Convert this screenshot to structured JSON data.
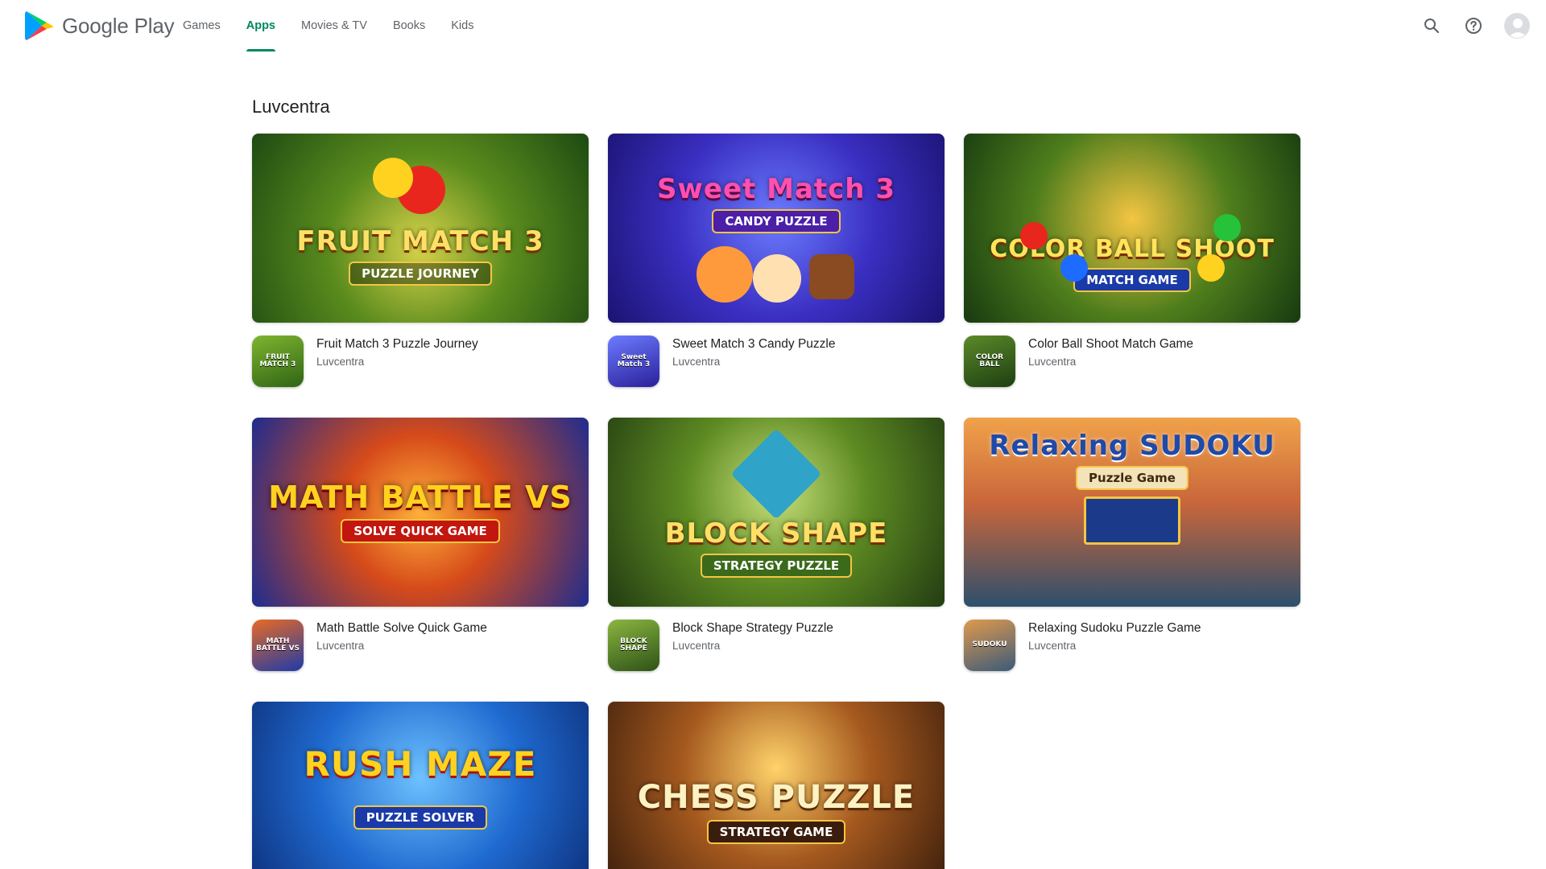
{
  "header": {
    "logo_text": "Google Play",
    "nav": [
      {
        "label": "Games",
        "active": false
      },
      {
        "label": "Apps",
        "active": true
      },
      {
        "label": "Movies & TV",
        "active": false
      },
      {
        "label": "Books",
        "active": false
      },
      {
        "label": "Kids",
        "active": false
      }
    ],
    "icons": [
      "search-icon",
      "help-icon",
      "account-avatar"
    ]
  },
  "accent_color": "#01875f",
  "page": {
    "title": "Luvcentra"
  },
  "apps": [
    {
      "name": "Fruit Match 3 Puzzle Journey",
      "developer": "Luvcentra",
      "banner_title": "FRUIT MATCH 3",
      "banner_sub": "PUZZLE JOURNEY",
      "icon_text": "FRUIT MATCH 3"
    },
    {
      "name": "Sweet Match 3 Candy Puzzle",
      "developer": "Luvcentra",
      "banner_title": "Sweet Match 3",
      "banner_sub": "CANDY PUZZLE",
      "icon_text": "Sweet Match 3"
    },
    {
      "name": "Color Ball Shoot Match Game",
      "developer": "Luvcentra",
      "banner_title": "COLOR BALL SHOOT",
      "banner_sub": "MATCH GAME",
      "icon_text": "COLOR BALL"
    },
    {
      "name": "Math Battle Solve Quick Game",
      "developer": "Luvcentra",
      "banner_title": "MATH BATTLE VS",
      "banner_sub": "SOLVE QUICK GAME",
      "icon_text": "MATH BATTLE VS"
    },
    {
      "name": "Block Shape Strategy Puzzle",
      "developer": "Luvcentra",
      "banner_title": "BLOCK SHAPE",
      "banner_sub": "STRATEGY PUZZLE",
      "icon_text": "BLOCK SHAPE"
    },
    {
      "name": "Relaxing Sudoku Puzzle Game",
      "developer": "Luvcentra",
      "banner_title": "Relaxing SUDOKU",
      "banner_sub": "Puzzle Game",
      "icon_text": "SUDOKU"
    },
    {
      "name": "",
      "developer": "",
      "banner_title": "RUSH MAZE",
      "banner_sub": "PUZZLE SOLVER"
    },
    {
      "name": "",
      "developer": "",
      "banner_title": "CHESS PUZZLE",
      "banner_sub": "STRATEGY GAME"
    }
  ]
}
